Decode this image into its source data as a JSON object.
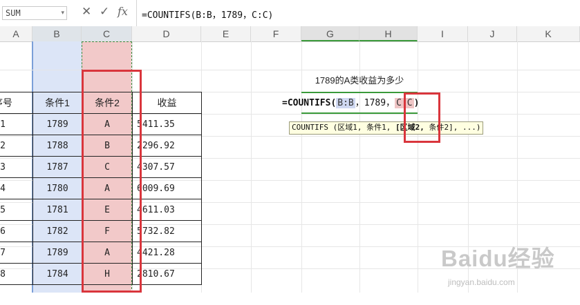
{
  "formula_bar": {
    "name_box": "SUM",
    "cancel_icon": "✕",
    "enter_icon": "✓",
    "fx_label": "fx",
    "formula": "=COUNTIFS(B:B，1789，C:C)"
  },
  "columns": [
    "A",
    "B",
    "C",
    "D",
    "E",
    "F",
    "G",
    "H",
    "I",
    "J",
    "K"
  ],
  "table": {
    "headers": [
      "序号",
      "条件1",
      "条件2",
      "收益"
    ],
    "rows": [
      {
        "id": "1",
        "c1": "1789",
        "c2": "A",
        "rev": "5411.35"
      },
      {
        "id": "2",
        "c1": "1788",
        "c2": "B",
        "rev": "2296.92"
      },
      {
        "id": "3",
        "c1": "1787",
        "c2": "C",
        "rev": "4307.57"
      },
      {
        "id": "4",
        "c1": "1780",
        "c2": "A",
        "rev": "6009.69"
      },
      {
        "id": "5",
        "c1": "1781",
        "c2": "E",
        "rev": "4611.03"
      },
      {
        "id": "6",
        "c1": "1782",
        "c2": "F",
        "rev": "5732.82"
      },
      {
        "id": "7",
        "c1": "1789",
        "c2": "A",
        "rev": "4421.28"
      },
      {
        "id": "8",
        "c1": "1784",
        "c2": "H",
        "rev": "2810.67"
      }
    ]
  },
  "question": "1789的A类收益为多少",
  "cell_formula": {
    "prefix": "=COUNTIFS(",
    "ref1": "B:B",
    "mid": "，1789，",
    "ref2": "C:C",
    "suffix": ")"
  },
  "tooltip": {
    "before": "COUNTIFS (区域1, 条件1, ",
    "active": "[区域2,",
    "after": " 条件2], ...)"
  },
  "watermark": {
    "brand": "Baidu经验",
    "url": "jingyan.baidu.com"
  },
  "colors": {
    "range_blue": "#dce5f7",
    "range_red": "#f2c9c9",
    "highlight_red": "#d9353c",
    "active_green": "#3a9a3a"
  }
}
